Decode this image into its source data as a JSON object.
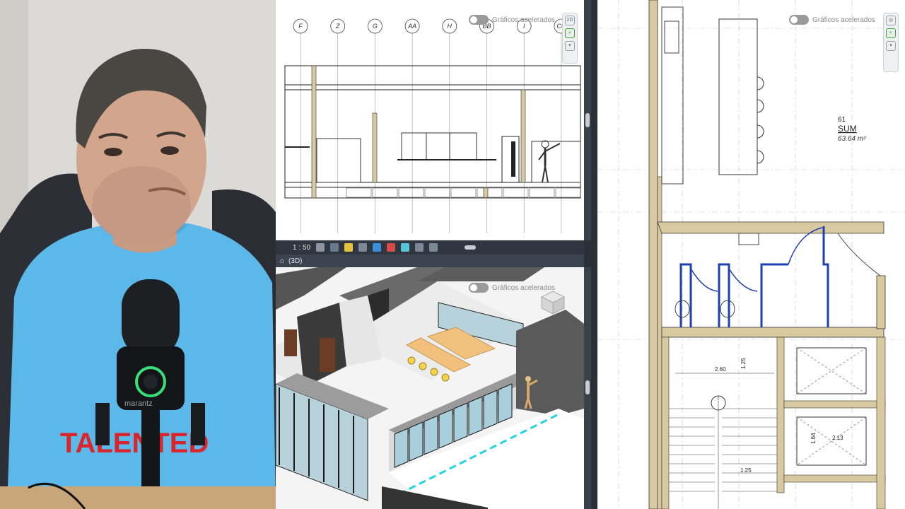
{
  "elevation_view": {
    "grid_labels": [
      "F",
      "Z",
      "G",
      "AA",
      "H",
      "BB",
      "I",
      "CC"
    ],
    "accelerated_toggle": "Gráficos acelerados"
  },
  "status_bar": {
    "scale": "1 : 50"
  },
  "view_3d": {
    "tab_label": "(3D)",
    "accelerated_toggle": "Gráficos acelerados"
  },
  "plan_view": {
    "accelerated_toggle": "Gráficos acelerados",
    "room_number": "61",
    "room_name": "SUM",
    "room_area": "63.64 m²",
    "dim_width": "2.60",
    "dim_height": "1.25",
    "dim_lower": "1.25",
    "dim_right_a": "2.13",
    "dim_right_b": "1.64"
  },
  "webcam": {
    "shirt_text": "TALENTED",
    "mic_brand": "marantz"
  },
  "colors": {
    "wall_fill": "#d9c9a0",
    "selection_blue": "#1f3fb0",
    "panel_dark": "#2f3640",
    "shirt_blue": "#5bb8e8"
  }
}
